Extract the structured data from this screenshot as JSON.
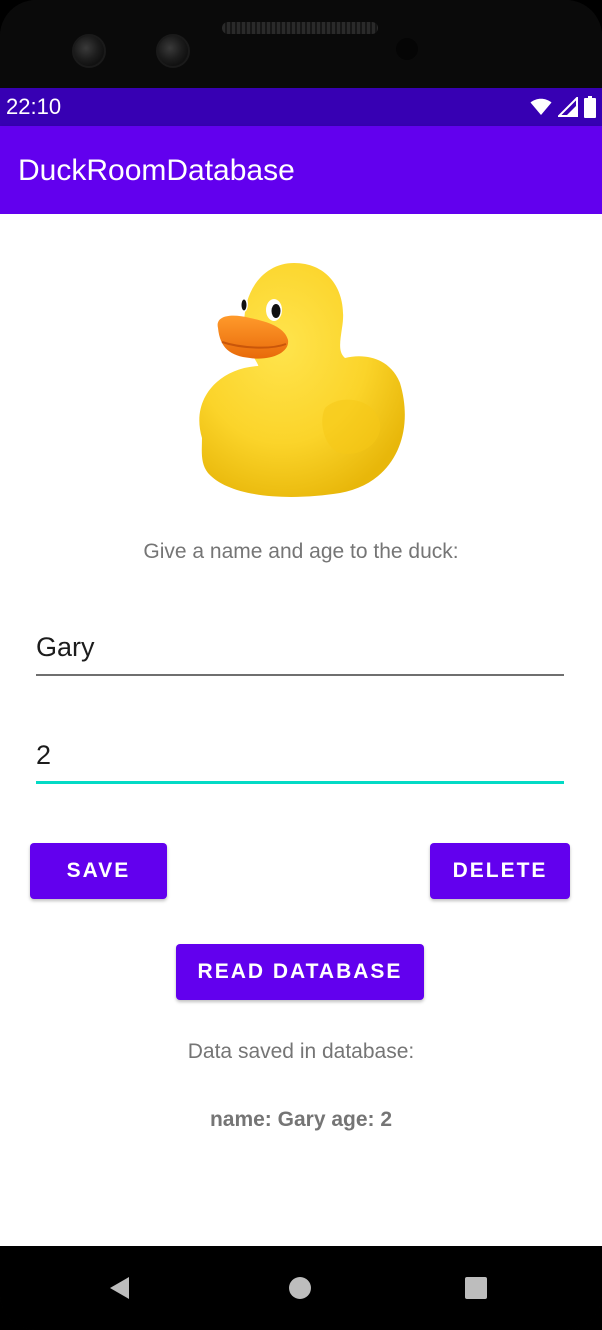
{
  "status_bar": {
    "time": "22:10",
    "icons": [
      "wifi-icon",
      "cell-signal-icon",
      "battery-icon"
    ]
  },
  "app_bar": {
    "title": "DuckRoomDatabase"
  },
  "main": {
    "duck_image": "rubber-duck-image",
    "prompt": "Give a name and age to the duck:",
    "name_field": {
      "value": "Gary"
    },
    "age_field": {
      "value": "2"
    },
    "buttons": {
      "save": "SAVE",
      "delete": "DELETE",
      "read": "READ DATABASE"
    },
    "saved_label": "Data saved in database:",
    "saved_value": "name: Gary age: 2"
  },
  "nav_bar": {
    "icons": [
      "back-icon",
      "home-icon",
      "recents-icon"
    ]
  },
  "colors": {
    "primary": "#6200EE",
    "primary_dark": "#3700B3",
    "accent": "#03DAC5",
    "text_secondary": "#757575"
  }
}
